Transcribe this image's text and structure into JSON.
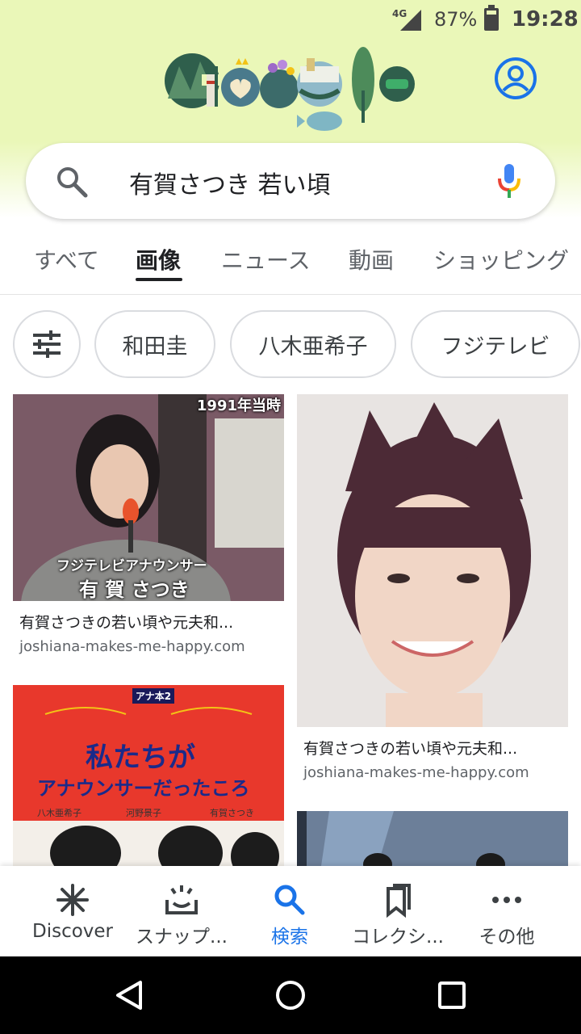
{
  "status_bar": {
    "network": "4G",
    "battery": "87%",
    "time": "19:28"
  },
  "search": {
    "query": "有賀さつき 若い頃"
  },
  "tabs": [
    {
      "label": "すべて",
      "active": false
    },
    {
      "label": "画像",
      "active": true
    },
    {
      "label": "ニュース",
      "active": false
    },
    {
      "label": "動画",
      "active": false
    },
    {
      "label": "ショッピング",
      "active": false
    }
  ],
  "chips": [
    {
      "label": "和田圭"
    },
    {
      "label": "八木亜希子"
    },
    {
      "label": "フジテレビ"
    }
  ],
  "results": [
    {
      "title": "有賀さつきの若い頃や元夫和...",
      "source": "joshiana-makes-me-happy.com",
      "image_caption_top": "1991年当時",
      "image_caption_sub": "フジテレビアナウンサー",
      "image_caption_name": "有 賀 さつき"
    },
    {
      "title": "有賀さつきの若い頃や元夫和...",
      "source": "joshiana-makes-me-happy.com"
    },
    {
      "book_series": "アナ本2",
      "book_title_1": "私たちが",
      "book_title_2": "アナウンサーだったころ",
      "book_authors": [
        "八木亜希子",
        "河野景子",
        "有賀さつき"
      ]
    }
  ],
  "bottom_nav": [
    {
      "label": "Discover",
      "icon": "asterisk-icon",
      "active": false
    },
    {
      "label": "スナップ...",
      "icon": "snapshot-icon",
      "active": false
    },
    {
      "label": "検索",
      "icon": "search-icon",
      "active": true
    },
    {
      "label": "コレクシ...",
      "icon": "bookmark-icon",
      "active": false
    },
    {
      "label": "その他",
      "icon": "more-dots-icon",
      "active": false
    }
  ],
  "colors": {
    "header_bg": "#eaf7b8",
    "accent": "#1a73e8"
  }
}
